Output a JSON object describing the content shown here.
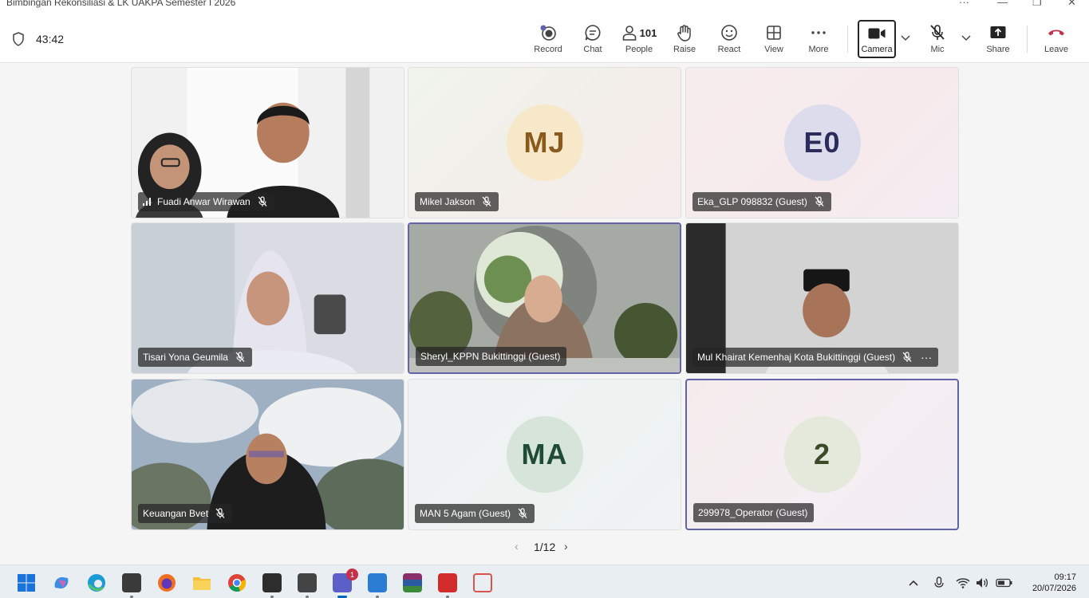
{
  "window": {
    "title": "Bimbingan Rekonsiliasi & LK UAKPA Semester I 2026"
  },
  "meeting": {
    "timer": "43:42",
    "people_count": "101",
    "toolbar": [
      {
        "key": "record",
        "label": "Record"
      },
      {
        "key": "chat",
        "label": "Chat"
      },
      {
        "key": "people",
        "label": "People"
      },
      {
        "key": "raise",
        "label": "Raise"
      },
      {
        "key": "react",
        "label": "React"
      },
      {
        "key": "view",
        "label": "View"
      },
      {
        "key": "more",
        "label": "More"
      },
      {
        "key": "camera",
        "label": "Camera"
      },
      {
        "key": "mic",
        "label": "Mic"
      },
      {
        "key": "share",
        "label": "Share"
      },
      {
        "key": "leave",
        "label": "Leave"
      }
    ]
  },
  "participants": [
    {
      "name": "Fuadi Anwar Wirawan",
      "type": "video",
      "muted": true
    },
    {
      "name": "Mikel Jakson",
      "type": "avatar",
      "initials": "MJ",
      "muted": true
    },
    {
      "name": "Eka_GLP 098832 (Guest)",
      "type": "avatar",
      "initials": "E0",
      "muted": true
    },
    {
      "name": "Tisari Yona Geumila",
      "type": "video",
      "muted": true
    },
    {
      "name": "Sheryl_KPPN Bukittinggi (Guest)",
      "type": "video",
      "speaking": true
    },
    {
      "name": "Mul Khairat Kemenhaj Kota Bukittinggi (Guest)",
      "type": "video",
      "muted": true
    },
    {
      "name": "Keuangan Bvet",
      "type": "video",
      "muted": true
    },
    {
      "name": "MAN 5 Agam (Guest)",
      "type": "avatar",
      "initials": "MA",
      "muted": true
    },
    {
      "name": "299978_Operator (Guest)",
      "type": "avatar",
      "initials": "2",
      "speaking": true
    }
  ],
  "pager": {
    "label": "1/12"
  },
  "taskbar": {
    "teams_badge": "1",
    "time": "09:17",
    "date": "20/07/2026"
  },
  "colors": {
    "accent": "#6264a7",
    "leave": "#c4314b"
  }
}
